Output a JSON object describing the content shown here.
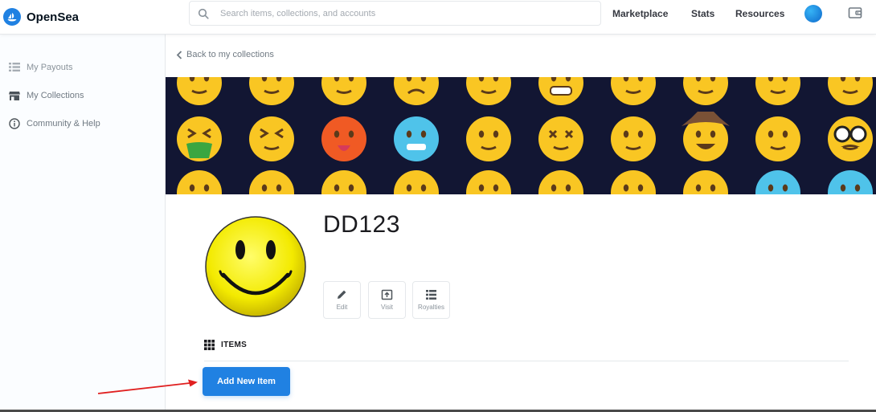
{
  "header": {
    "brand_name": "OpenSea",
    "search_placeholder": "Search items, collections, and accounts",
    "nav": [
      "Marketplace",
      "Stats",
      "Resources"
    ]
  },
  "sidebar": {
    "items": [
      {
        "label": "My Payouts",
        "icon": "list-icon"
      },
      {
        "label": "My Collections",
        "icon": "storefront-icon"
      },
      {
        "label": "Community & Help",
        "icon": "info-icon"
      }
    ]
  },
  "main": {
    "back_link": "Back to my collections",
    "collection_name": "DD123",
    "actions": [
      {
        "label": "Edit",
        "icon": "pencil-icon"
      },
      {
        "label": "Visit",
        "icon": "open-box-icon"
      },
      {
        "label": "Royalties",
        "icon": "list-icon"
      }
    ],
    "items_heading": "ITEMS",
    "add_item_label": "Add New Item"
  },
  "colors": {
    "brand_blue": "#2081e2",
    "banner_bg": "#121633",
    "annotation_arrow": "#e02020"
  }
}
